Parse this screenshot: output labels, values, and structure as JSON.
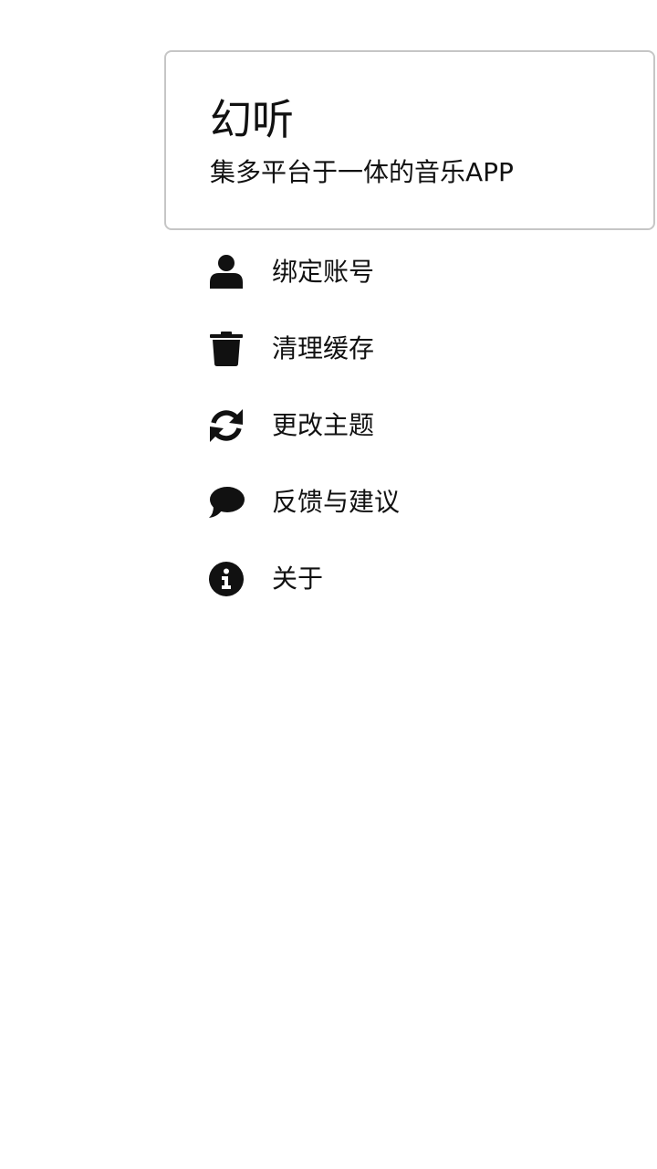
{
  "header": {
    "app_name": "幻听",
    "description": "集多平台于一体的音乐APP"
  },
  "menu": {
    "items": [
      {
        "label": "绑定账号",
        "icon": "user-icon"
      },
      {
        "label": "清理缓存",
        "icon": "trash-icon"
      },
      {
        "label": "更改主题",
        "icon": "refresh-icon"
      },
      {
        "label": "反馈与建议",
        "icon": "chat-bubble-icon"
      },
      {
        "label": "关于",
        "icon": "info-icon"
      }
    ]
  },
  "colors": {
    "text": "#111111",
    "icon": "#111111",
    "card_border": "#c6c6c6",
    "background": "#ffffff"
  }
}
